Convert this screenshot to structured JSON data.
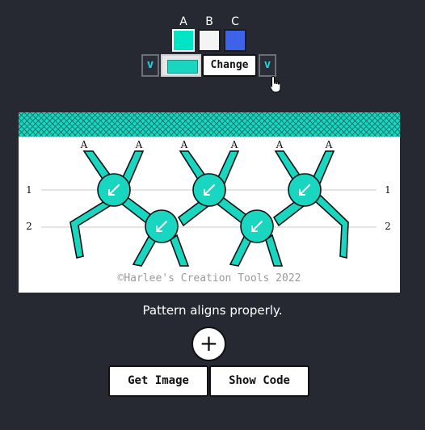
{
  "color_picker": {
    "columns": [
      {
        "label": "A",
        "color": "#00e5c6",
        "selected": true
      },
      {
        "label": "B",
        "color": "#f4f4f4",
        "selected": false
      },
      {
        "label": "C",
        "color": "#3f63e8",
        "selected": false
      }
    ],
    "toggle_left_label": "v",
    "toggle_right_label": "v",
    "preview_color": "#19d6c0",
    "change_label": "Change"
  },
  "pattern": {
    "strand_labels": [
      "A",
      "A",
      "A",
      "A",
      "A",
      "A"
    ],
    "row_labels": [
      "1",
      "2"
    ],
    "knot_color": "#19d6c0",
    "header_color": "#19d6c0",
    "watermark": "©Harlee's Creation Tools 2022"
  },
  "status_message": "Pattern aligns properly.",
  "actions": {
    "add_label": "+",
    "get_image_label": "Get Image",
    "show_code_label": "Show Code"
  }
}
